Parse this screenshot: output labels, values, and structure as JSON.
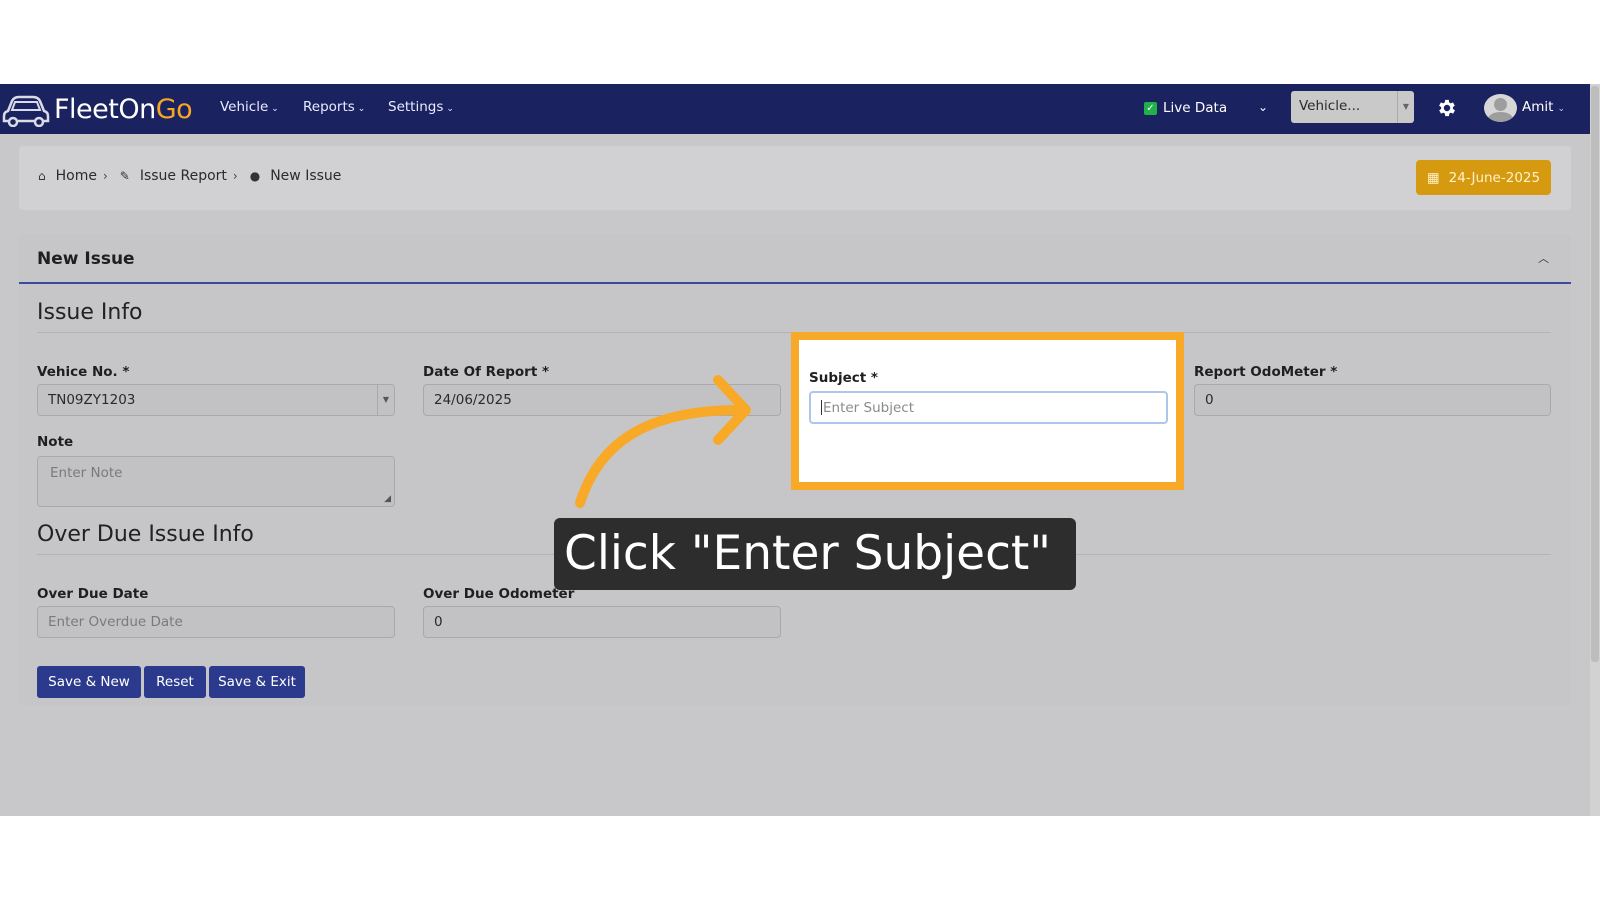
{
  "nav": {
    "brand_part1": "FleetOn",
    "brand_part2": "Go",
    "menus": [
      "Vehicle",
      "Reports",
      "Settings"
    ],
    "live_data_label": "Live Data",
    "vehicle_select": "Vehicle...",
    "user_name": "Amit"
  },
  "breadcrumb": {
    "home": "Home",
    "issue_report": "Issue Report",
    "current": "New Issue"
  },
  "date_button": "24-June-2025",
  "card": {
    "title": "New Issue",
    "issue_info": "Issue Info",
    "vehicle_no_label": "Vehice No. *",
    "vehicle_no_value": "TN09ZY1203",
    "date_of_report_label": "Date Of Report *",
    "date_of_report_value": "24/06/2025",
    "subject_label": "Subject *",
    "subject_placeholder": "Enter Subject",
    "report_odometer_label": "Report OdoMeter *",
    "report_odometer_value": "0",
    "note_label": "Note",
    "note_placeholder": "Enter Note",
    "overdue_section": "Over Due Issue Info",
    "overdue_date_label": "Over Due Date",
    "overdue_date_placeholder": "Enter Overdue Date",
    "overdue_odometer_label": "Over Due Odometer",
    "overdue_odometer_value": "0",
    "buttons": {
      "save_new": "Save & New",
      "reset": "Reset",
      "save_exit": "Save & Exit"
    }
  },
  "callout": "Click \"Enter Subject\"",
  "colors": {
    "nav_bg": "#1b2260",
    "accent_orange": "#f8a928",
    "button_blue": "#2c3a8d",
    "date_button": "#d69a11"
  }
}
